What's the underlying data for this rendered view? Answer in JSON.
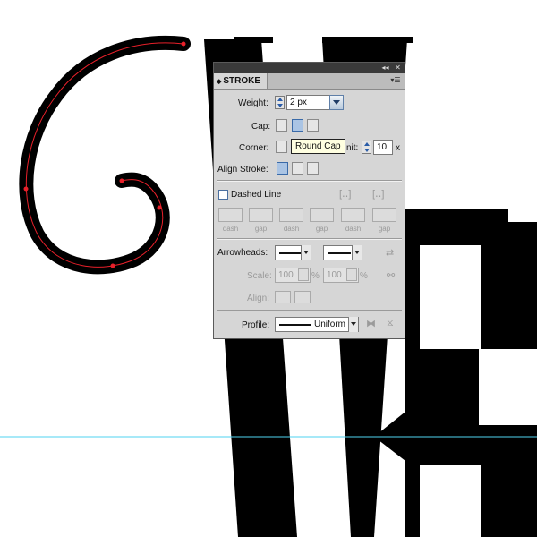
{
  "panel": {
    "title": "STROKE",
    "weight": {
      "label": "Weight:",
      "value": "2 px"
    },
    "cap": {
      "label": "Cap:",
      "tooltip": "Round Cap"
    },
    "corner": {
      "label": "Corner:",
      "limit_label": "nit:",
      "limit_value": "10",
      "limit_suffix": "x"
    },
    "align_stroke": {
      "label": "Align Stroke:"
    },
    "dashed_line": {
      "label": "Dashed Line",
      "checked": false
    },
    "dash_labels": [
      "dash",
      "gap",
      "dash",
      "gap",
      "dash",
      "gap"
    ],
    "arrowheads": {
      "label": "Arrowheads:"
    },
    "scale": {
      "label": "Scale:",
      "start_value": "100",
      "end_value": "100",
      "unit": "%"
    },
    "align": {
      "label": "Align:"
    },
    "profile": {
      "label": "Profile:",
      "value": "Uniform"
    }
  },
  "colors": {
    "panel_bg": "#d6d6d6",
    "tooltip_bg": "#ffffe1",
    "path_red": "#e8202a",
    "guide_cyan": "#4fd3f0",
    "glyph_black": "#000000"
  }
}
